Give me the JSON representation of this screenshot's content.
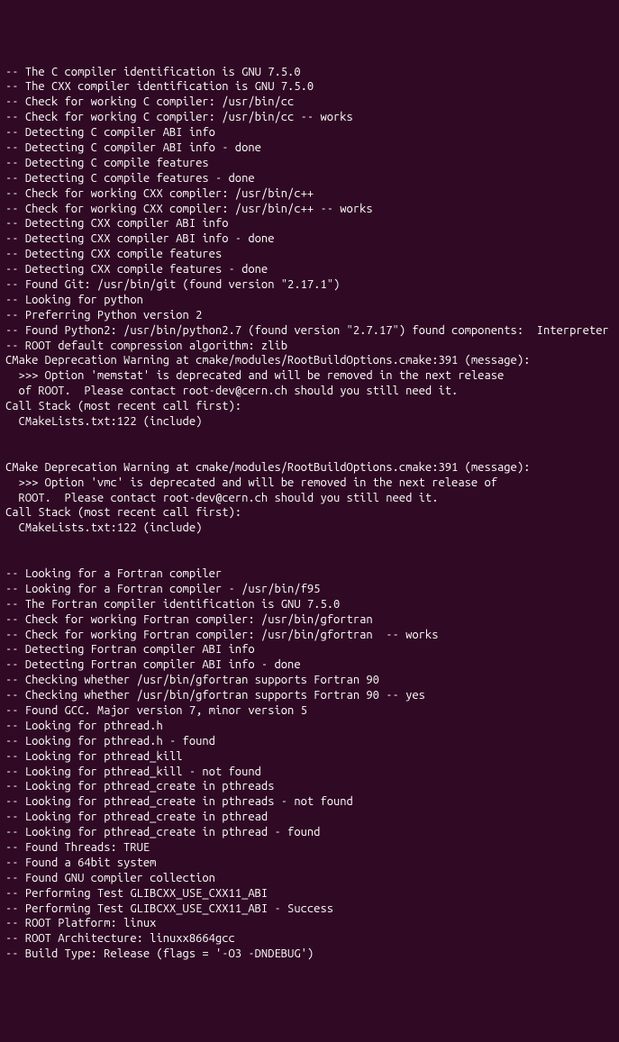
{
  "terminal": {
    "lines": [
      "-- The C compiler identification is GNU 7.5.0",
      "-- The CXX compiler identification is GNU 7.5.0",
      "-- Check for working C compiler: /usr/bin/cc",
      "-- Check for working C compiler: /usr/bin/cc -- works",
      "-- Detecting C compiler ABI info",
      "-- Detecting C compiler ABI info - done",
      "-- Detecting C compile features",
      "-- Detecting C compile features - done",
      "-- Check for working CXX compiler: /usr/bin/c++",
      "-- Check for working CXX compiler: /usr/bin/c++ -- works",
      "-- Detecting CXX compiler ABI info",
      "-- Detecting CXX compiler ABI info - done",
      "-- Detecting CXX compile features",
      "-- Detecting CXX compile features - done",
      "-- Found Git: /usr/bin/git (found version \"2.17.1\")",
      "-- Looking for python",
      "-- Preferring Python version 2",
      "-- Found Python2: /usr/bin/python2.7 (found version \"2.7.17\") found components:  Interpreter",
      "-- ROOT default compression algorithm: zlib",
      "CMake Deprecation Warning at cmake/modules/RootBuildOptions.cmake:391 (message):",
      "  >>> Option 'memstat' is deprecated and will be removed in the next release",
      "  of ROOT.  Please contact root-dev@cern.ch should you still need it.",
      "Call Stack (most recent call first):",
      "  CMakeLists.txt:122 (include)",
      "",
      "",
      "CMake Deprecation Warning at cmake/modules/RootBuildOptions.cmake:391 (message):",
      "  >>> Option 'vmc' is deprecated and will be removed in the next release of",
      "  ROOT.  Please contact root-dev@cern.ch should you still need it.",
      "Call Stack (most recent call first):",
      "  CMakeLists.txt:122 (include)",
      "",
      "",
      "-- Looking for a Fortran compiler",
      "-- Looking for a Fortran compiler - /usr/bin/f95",
      "-- The Fortran compiler identification is GNU 7.5.0",
      "-- Check for working Fortran compiler: /usr/bin/gfortran",
      "-- Check for working Fortran compiler: /usr/bin/gfortran  -- works",
      "-- Detecting Fortran compiler ABI info",
      "-- Detecting Fortran compiler ABI info - done",
      "-- Checking whether /usr/bin/gfortran supports Fortran 90",
      "-- Checking whether /usr/bin/gfortran supports Fortran 90 -- yes",
      "-- Found GCC. Major version 7, minor version 5",
      "-- Looking for pthread.h",
      "-- Looking for pthread.h - found",
      "-- Looking for pthread_kill",
      "-- Looking for pthread_kill - not found",
      "-- Looking for pthread_create in pthreads",
      "-- Looking for pthread_create in pthreads - not found",
      "-- Looking for pthread_create in pthread",
      "-- Looking for pthread_create in pthread - found",
      "-- Found Threads: TRUE",
      "-- Found a 64bit system",
      "-- Found GNU compiler collection",
      "-- Performing Test GLIBCXX_USE_CXX11_ABI",
      "-- Performing Test GLIBCXX_USE_CXX11_ABI - Success",
      "-- ROOT Platform: linux",
      "-- ROOT Architecture: linuxx8664gcc",
      "-- Build Type: Release (flags = '-O3 -DNDEBUG')"
    ]
  }
}
